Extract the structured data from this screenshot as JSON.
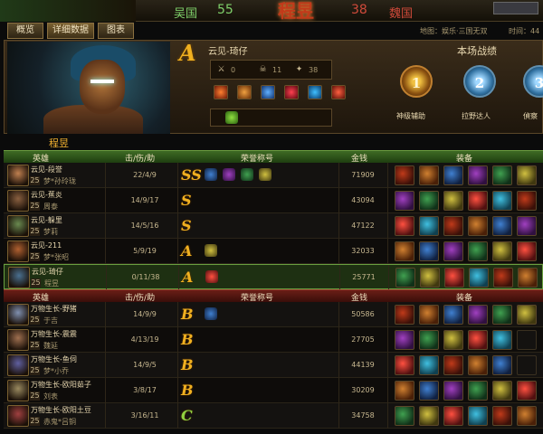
{
  "topbar": {
    "team_left": "吴国",
    "score_left": "55",
    "logo_text": "程昱",
    "score_right": "38",
    "team_right": "魏国",
    "colors": {
      "left": "#7fd06a",
      "right": "#d04a3a"
    }
  },
  "tabs": [
    {
      "label": "概览",
      "active": false
    },
    {
      "label": "详细数据",
      "active": true
    },
    {
      "label": "图表",
      "active": false
    }
  ],
  "map_info": "地图：娱乐·三国无双",
  "time_info": "时间：44",
  "mvp": {
    "grade": "A",
    "name": "云见-琦仔",
    "stats": [
      {
        "icon": "swords-icon",
        "value": "0"
      },
      {
        "icon": "skull-icon",
        "value": "11"
      },
      {
        "icon": "assist-icon",
        "value": "38"
      }
    ],
    "record_title": "本场战绩",
    "medals": [
      {
        "number": "1",
        "label": "神级辅助"
      },
      {
        "number": "2",
        "label": "拉野达人"
      },
      {
        "number": "3",
        "label": "偵察"
      }
    ]
  },
  "section_name": "程昱",
  "columns": {
    "hero": "英雄",
    "kda": "击/伤/助",
    "honor": "荣誉称号",
    "gold": "金钱",
    "equip": "装备"
  },
  "team_a": [
    {
      "hero": "云见-段誉",
      "level": "25",
      "player": "梦*孙玲珑",
      "kda": "22/4/9",
      "grade": "SS",
      "gold": "71909",
      "honors": 4,
      "items": 6
    },
    {
      "hero": "云见-蕉炎",
      "level": "25",
      "player": "周泰",
      "kda": "14/9/17",
      "grade": "S",
      "gold": "43094",
      "honors": 0,
      "items": 6
    },
    {
      "hero": "云见-躲里",
      "level": "25",
      "player": "梦莉",
      "kda": "14/5/16",
      "grade": "S",
      "gold": "47122",
      "honors": 0,
      "items": 6
    },
    {
      "hero": "云见-211",
      "level": "25",
      "player": "梦*张昭",
      "kda": "5/9/19",
      "grade": "A",
      "gold": "32033",
      "honors": 1,
      "items": 6
    },
    {
      "hero": "云见-琦仔",
      "level": "25",
      "player": "程昱",
      "kda": "0/11/38",
      "grade": "A",
      "gold": "25771",
      "honors": 1,
      "items": 6
    }
  ],
  "team_b": [
    {
      "hero": "万物生长-野猪",
      "level": "25",
      "player": "于吉",
      "kda": "14/9/9",
      "grade": "B",
      "gold": "50586",
      "honors": 1,
      "items": 6
    },
    {
      "hero": "万物生长-震震",
      "level": "25",
      "player": "魏延",
      "kda": "4/13/19",
      "grade": "B",
      "gold": "27705",
      "honors": 0,
      "items": 5
    },
    {
      "hero": "万物生长-鱼伺",
      "level": "25",
      "player": "梦*小乔",
      "kda": "14/9/5",
      "grade": "B",
      "gold": "44139",
      "honors": 0,
      "items": 5
    },
    {
      "hero": "万物生长-欧阳茹子",
      "level": "25",
      "player": "刘表",
      "kda": "3/8/17",
      "grade": "B",
      "gold": "30209",
      "honors": 0,
      "items": 6
    },
    {
      "hero": "万物生长-欧阳土豆",
      "level": "25",
      "player": "赤鬼*吕铜",
      "kda": "3/16/11",
      "grade": "C",
      "gold": "34758",
      "honors": 0,
      "items": 6
    }
  ]
}
